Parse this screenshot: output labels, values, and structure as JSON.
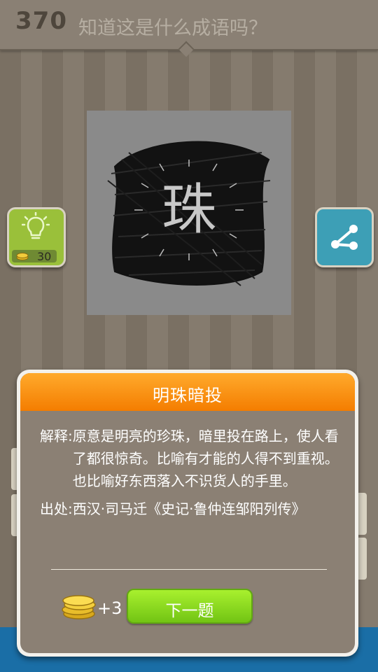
{
  "header": {
    "level": "370",
    "question": "知道这是什么成语吗？"
  },
  "puzzle": {
    "character": "珠"
  },
  "hint": {
    "icon": "lightbulb-icon",
    "cost": "30"
  },
  "share": {
    "icon": "share-icon"
  },
  "dialog": {
    "title": "明珠暗投",
    "explanation_label": "解释:",
    "explanation": "原意是明亮的珍珠，暗里投在路上，使人看了都很惊奇。比喻有才能的人得不到重视。也比喻好东西落入不识货人的手里。",
    "source_label": "出处:",
    "source": "西汉·司马迁《史记·鲁仲连邹阳列传》",
    "reward": "+3",
    "next_label": "下一题"
  },
  "colors": {
    "header_orange": "#f47d00",
    "next_green": "#8ad91f",
    "hint_green": "#9ac03a",
    "share_blue": "#3d9fb6"
  }
}
